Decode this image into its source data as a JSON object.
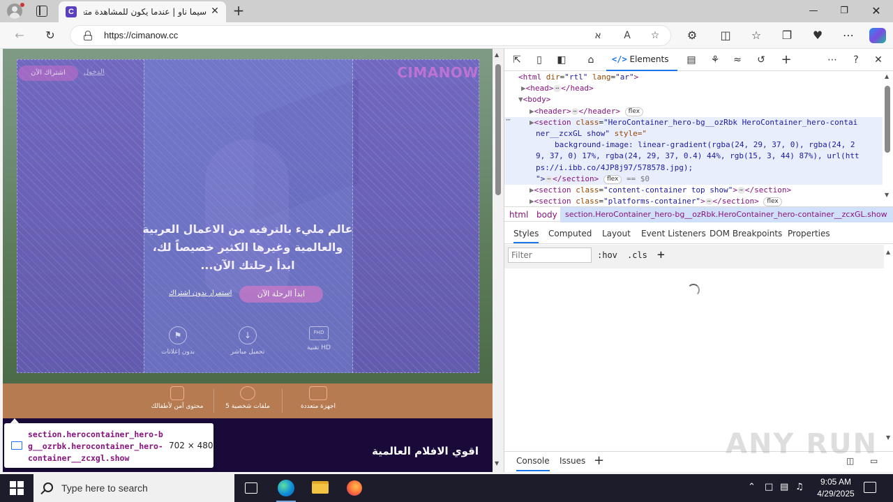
{
  "browser": {
    "tab_title": "سيما ناو | عندما يكون للمشاهدة متعة",
    "tab_favicon": "C",
    "url": "https://cimanow.cc",
    "new_tab": "+",
    "close": "✕",
    "minimize": "—",
    "maximize": "❐"
  },
  "site": {
    "logo": "CIMANOW",
    "subscribe_button": "اشتراك الآن",
    "login_link": "الدخول",
    "hero_text": "عالم مليء بالترفيه من الاعمال العربية والعالمية وغيرها الكثير خصيصاً لك، ابدأ رحلتك الآن...",
    "start_button": "ابدأ الرحلة الآن",
    "continue_link": "استمرار بدون اشتراك",
    "features": [
      {
        "label": "تقنية HD",
        "icon": "FHD"
      },
      {
        "label": "تحميل مباشر",
        "icon": "download-icon"
      },
      {
        "label": "بدون إعلانات",
        "icon": "no-ads-icon"
      }
    ],
    "band_items": [
      {
        "label": "اجهزة متعددة",
        "icon": "devices-icon"
      },
      {
        "label": "5 ملفات شخصية",
        "icon": "profiles-icon"
      },
      {
        "label": "محتوى آمن لأطفالك",
        "icon": "kids-icon"
      }
    ],
    "movies_title": "اقوي الافلام العالمية"
  },
  "inspect_tooltip": {
    "selector": "section.herocontainer_hero-bg__ozrbk.herocontainer_hero-container__zcxgl.show",
    "size": "702 × 480"
  },
  "devtools": {
    "elements_tab": "Elements",
    "dom": {
      "html_line": {
        "tag": "html",
        "dir_attr": "dir",
        "dir_val": "\"rtl\"",
        "lang_attr": "lang",
        "lang_val": "\"ar\""
      },
      "head": "<head>",
      "head_close": "</head>",
      "body": "<body>",
      "header": "<header>",
      "header_close": "</header>",
      "section1_class": "\"HeroContainer_hero-bg__ozRbk HeroContainer_hero-contai",
      "section1_class2": "ner__zcxGL show\"",
      "style_attr": "style=\"",
      "style_line1": "background-image: linear-gradient(rgba(24, 29, 37, 0), rgba(24, 2",
      "style_line2": "9, 37, 0) 17%, rgba(24, 29, 37, 0.4) 44%, rgb(15, 3, 44) 87%), url(htt",
      "style_line3": "ps://i.ibb.co/4JP8j97/578578.jpg);",
      "style_line4_end": "\">",
      "section_close": "</section>",
      "eq_sign": "== $0",
      "section2_class": "\"content-container top show\"",
      "section3_class": "\"platforms-container\"",
      "flex": "flex",
      "section_word": "section",
      "class_word": "class"
    },
    "breadcrumb": {
      "html": "html",
      "body": "body",
      "active": "section.HeroContainer_hero-bg__ozRbk.HeroContainer_hero-container__zcxGL.show"
    },
    "styles_tabs": [
      "Styles",
      "Computed",
      "Layout",
      "Event Listeners",
      "DOM Breakpoints",
      "Properties"
    ],
    "filter_placeholder": "Filter",
    "hov": ":hov",
    "cls": ".cls",
    "drawer_tabs": [
      "Console",
      "Issues"
    ]
  },
  "watermark": "ANY RUN",
  "taskbar": {
    "search_placeholder": "Type here to search",
    "time": "9:05 AM",
    "date": "4/29/2025"
  },
  "colors": {
    "overlay": "#6c54d6",
    "brand_pink": "#d278c8",
    "devtools_accent": "#1a73e8",
    "orange_band": "#b77b52",
    "dark_band": "#190a3a"
  }
}
